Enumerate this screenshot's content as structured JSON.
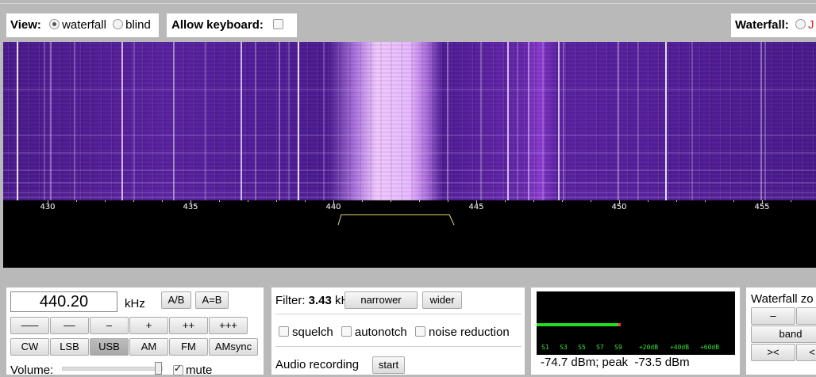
{
  "top": {
    "view_label": "View:",
    "view_options": [
      "waterfall",
      "blind"
    ],
    "view_selected": "waterfall",
    "keyboard_label": "Allow keyboard:",
    "waterfall_label": "Waterfall:"
  },
  "scale": {
    "ticks": [
      "430",
      "435",
      "440",
      "445",
      "450",
      "455"
    ]
  },
  "freq": {
    "value": "440.20",
    "unit": "kHz",
    "ab_label": "A/B",
    "aeqb_label": "A=B",
    "step_buttons": [
      "–––",
      "––",
      "–",
      "+",
      "++",
      "+++"
    ],
    "modes": [
      "CW",
      "LSB",
      "USB",
      "AM",
      "FM",
      "AMsync"
    ],
    "selected_mode": "USB",
    "volume_label": "Volume:",
    "mute_label": "mute",
    "volume_level_fraction": 0.97
  },
  "filter": {
    "label": "Filter:",
    "value": "3.43",
    "unit": "kHz",
    "narrower_label": "narrower",
    "wider_label": "wider",
    "squelch_label": "squelch",
    "autonotch_label": "autonotch",
    "noise_reduction_label": "noise reduction",
    "audio_recording_label": "Audio recording",
    "start_label": "start"
  },
  "smeter": {
    "scale_labels": [
      "S1",
      "S3",
      "S5",
      "S7",
      "S9",
      "+20dB",
      "+40dB",
      "+60dB"
    ],
    "level_fraction": 0.41,
    "readout": "-74.7 dBm; peak  -73.5 dBm",
    "bar_color": "#22dd22",
    "peak_color": "#ff3333"
  },
  "zoom": {
    "title": "Waterfall zo",
    "minus_label": "–",
    "band_label": "band",
    "swap_label": "><",
    "left_label": "<"
  }
}
